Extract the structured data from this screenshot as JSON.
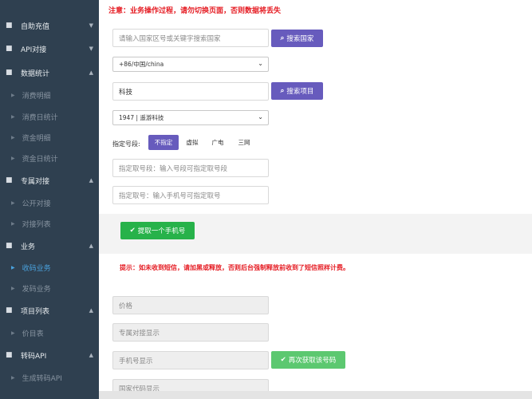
{
  "sidebar": {
    "items": [
      {
        "type": "group",
        "icon": "folder-icon",
        "label": "自助充值",
        "arrow": "▼"
      },
      {
        "type": "group",
        "icon": "folder-icon",
        "label": "API对接",
        "arrow": "▼"
      },
      {
        "type": "group",
        "icon": "folder-icon",
        "label": "数据统计",
        "arrow": "▲"
      },
      {
        "type": "sub",
        "label": "消费明细"
      },
      {
        "type": "sub",
        "label": "消费日统计"
      },
      {
        "type": "sub",
        "label": "资金明细"
      },
      {
        "type": "sub",
        "label": "资金日统计"
      },
      {
        "type": "group",
        "icon": "folder-icon",
        "label": "专属对接",
        "arrow": "▲"
      },
      {
        "type": "sub",
        "label": "公开对接"
      },
      {
        "type": "sub",
        "label": "对接列表"
      },
      {
        "type": "group",
        "icon": "folder-icon",
        "label": "业务",
        "arrow": "▲"
      },
      {
        "type": "sub",
        "label": "收码业务",
        "active": true
      },
      {
        "type": "sub",
        "label": "发码业务"
      },
      {
        "type": "group",
        "icon": "folder-icon",
        "label": "项目列表",
        "arrow": "▲"
      },
      {
        "type": "sub",
        "label": "价目表"
      },
      {
        "type": "group",
        "icon": "folder-icon",
        "label": "转码API",
        "arrow": "▲"
      },
      {
        "type": "sub",
        "label": "生成转码API"
      }
    ]
  },
  "main": {
    "warning": "注意：业务操作过程，请勿切换页面，否则数据将丢失",
    "country_search": {
      "placeholder": "请输入国家区号或关键字搜索国家",
      "button": "搜索国家"
    },
    "country_select": {
      "value": "+86/中国/china"
    },
    "project_search": {
      "value": "科技",
      "button": "搜索项目"
    },
    "project_select": {
      "value": "1947 | 遥游科技"
    },
    "segment": {
      "label": "指定号段:",
      "options": [
        "不指定",
        "虚拟",
        "广电",
        "三网"
      ],
      "selected": "不指定"
    },
    "segment_input": {
      "placeholder": "指定取号段：输入号段可指定取号段"
    },
    "phone_input": {
      "placeholder": "指定取号：输入手机号可指定取号"
    },
    "fetch_button": "提取一个手机号",
    "tip": "提示：如未收到短信，请加黑或释放，否则后台强制释放前收到了短信照样计费。",
    "fields": {
      "price": "价格",
      "exclusive": "专属对接显示",
      "phone": "手机号显示",
      "country_code": "国家代码显示"
    },
    "refetch_button": "再次获取该号码",
    "colors": {
      "sidebar": "#2f4050",
      "primary": "#675bbd",
      "success": "#27b24a",
      "danger": "#e51c23",
      "active": "#4aa3df"
    }
  }
}
